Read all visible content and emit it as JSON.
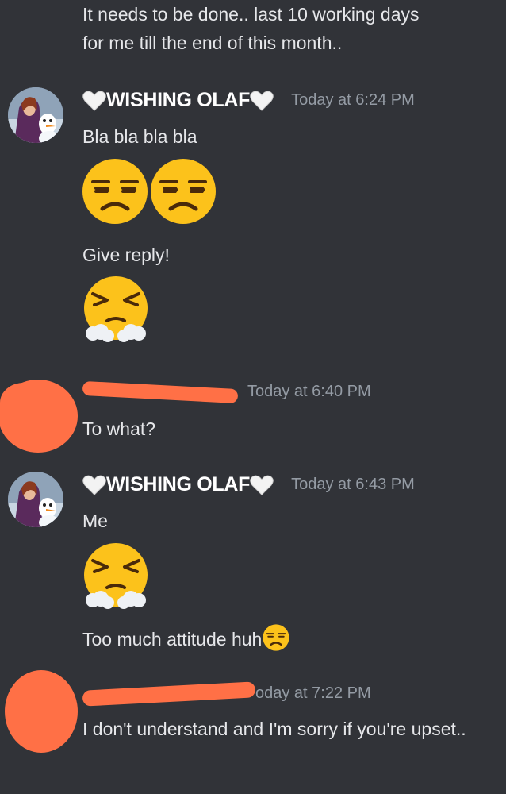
{
  "messages": [
    {
      "continuation": true,
      "lines": [
        "It needs to be done.. last 10 working days",
        "for me till the end of this month.."
      ]
    },
    {
      "username": "WISHING OLAF",
      "timestamp": "Today at 6:24 PM",
      "text1": "Bla bla bla bla",
      "emojis1": [
        "unamused-face-emoji",
        "unamused-face-emoji"
      ],
      "text2": "Give reply!",
      "emojis2": [
        "face-with-steam-from-nose-emoji"
      ]
    },
    {
      "username_redacted": true,
      "timestamp": "Today at 6:40 PM",
      "text": "To what?"
    },
    {
      "username": "WISHING OLAF",
      "timestamp": "Today at 6:43 PM",
      "text1": "Me",
      "emojis1": [
        "face-with-steam-from-nose-emoji"
      ],
      "text2": "Too much attitude huh",
      "inline_emoji": "unamused-face-emoji"
    },
    {
      "username_redacted": true,
      "timestamp": "oday at 7:22 PM",
      "text": "I don't understand and I'm sorry if you're upset.."
    }
  ],
  "colors": {
    "background": "#313338",
    "text": "#e6e7ea",
    "username": "#ffffff",
    "timestamp": "#949ba4",
    "redaction": "#ff7046"
  }
}
